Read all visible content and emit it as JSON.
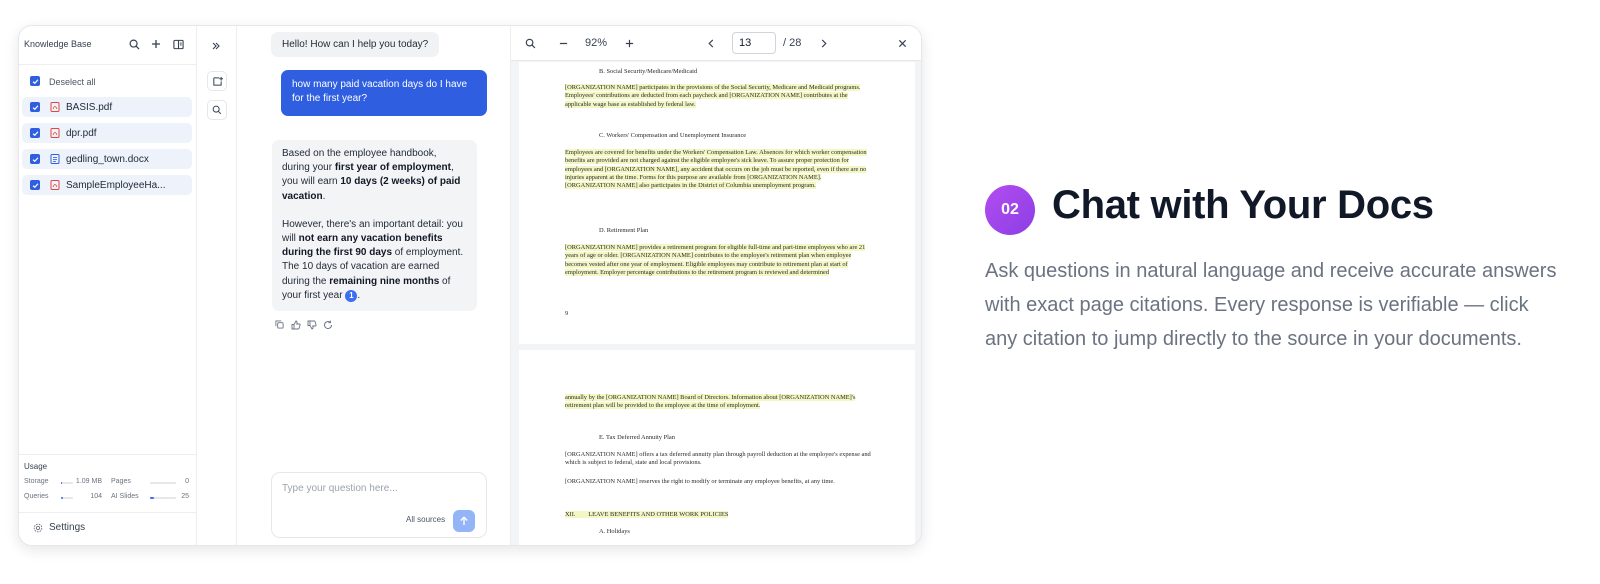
{
  "sidebar": {
    "title": "Knowledge Base",
    "deselect_all": "Deselect all",
    "files": [
      {
        "name": "BASIS.pdf",
        "type": "pdf"
      },
      {
        "name": "dpr.pdf",
        "type": "pdf"
      },
      {
        "name": "gedling_town.docx",
        "type": "docx"
      },
      {
        "name": "SampleEmployeeHa...",
        "type": "pdf"
      }
    ],
    "usage": {
      "title": "Usage",
      "storage_label": "Storage",
      "storage_value": "1.09 MB",
      "pages_label": "Pages",
      "pages_value": "0",
      "queries_label": "Queries",
      "queries_value": "104",
      "ai_slides_label": "AI Slides",
      "ai_slides_value": "25"
    },
    "settings_label": "Settings"
  },
  "chat": {
    "greeting": "Hello! How can I help you today?",
    "user_question": "how many paid vacation days do I have for the first year?",
    "answer": {
      "p1_a": "Based on the employee handbook, during your ",
      "p1_b": "first year of employment",
      "p1_c": ", you will earn ",
      "p1_d": "10 days (2 weeks) of paid vacation",
      "p1_e": ".",
      "p2_a": "However, there's an important detail: you will ",
      "p2_b": "not earn any vacation benefits during the first 90 days",
      "p2_c": " of employment. The 10 days of vacation are earned during the ",
      "p2_d": "remaining nine months",
      "p2_e": " of your first year ",
      "citation": "1",
      "p2_f": "."
    },
    "input_placeholder": "Type your question here...",
    "sources_label": "All sources"
  },
  "viewer": {
    "zoom": "92%",
    "current_page": "13",
    "total_pages": "/ 28",
    "page1": {
      "h1": "B.   Social Security/Medicare/Medicaid",
      "p1": "[ORGANIZATION NAME] participates in the provisions of the Social Security, Medicare and Medicaid programs. Employees' contributions are deducted from each paycheck and [ORGANIZATION NAME] contributes at the applicable wage base as established by federal law.",
      "h2": "C.   Workers' Compensation and Unemployment Insurance",
      "p2": "Employees are covered for benefits under the Workers' Compensation Law. Absences for which worker compensation benefits are provided are not charged against the eligible employee's sick leave. To assure proper protection for employees and [ORGANIZATION NAME], any accident that occurs on the job must be reported, even if there are no injuries apparent at the time. Forms for this purpose are available from [ORGANIZATION NAME]. [ORGANIZATION NAME] also participates in the District of Columbia unemployment program.",
      "h3": "D.   Retirement Plan",
      "p3": "[ORGANIZATION NAME] provides a retirement program for eligible full-time and part-time employees who are 21 years of age or older. [ORGANIZATION NAME] contributes to the employee's retirement plan when employee becomes vested after one year of employment. Eligible employees may contribute to retirement plan at start of employment. Employer percentage contributions to the retirement program is reviewed and determined",
      "page_no": "9"
    },
    "page2": {
      "p1": "annually by the [ORGANIZATION NAME] Board of Directors. Information about [ORGANIZATION NAME]'s retirement plan will be provided to the employee at the time of employment.",
      "h1": "E.   Tax Deferred Annuity Plan",
      "p2": "[ORGANIZATION NAME] offers a tax deferred annuity plan through payroll deduction at the employee's expense and which is subject to federal, state and local provisions.",
      "p3": "[ORGANIZATION NAME] reserves the right to modify or terminate any employee benefits, at any time.",
      "h2": "XII.        LEAVE BENEFITS AND OTHER WORK POLICIES",
      "h3": "A.   Holidays"
    }
  },
  "feature": {
    "badge": "02",
    "title": "Chat with Your Docs",
    "body": "Ask questions in natural language and receive accurate answers with exact page citations. Every response is verifiable — click any citation to jump directly to the source in your documents."
  },
  "colors": {
    "accent_blue": "#2f5fe0",
    "badge_purple": "#a245ee",
    "highlight": "#f3f7c4"
  }
}
